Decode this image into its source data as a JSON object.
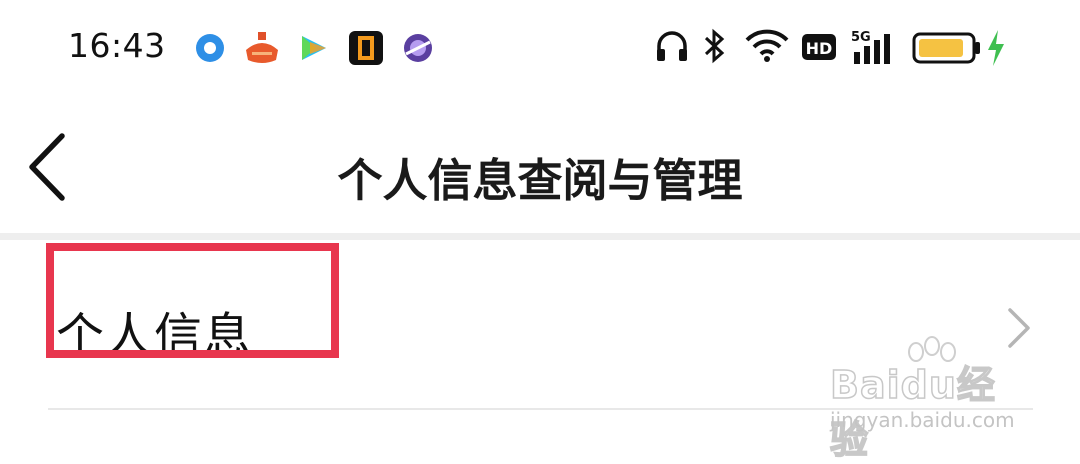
{
  "status_bar": {
    "time": "16:43",
    "app_icons": [
      "blue-circle-app-icon",
      "orange-pot-app-icon",
      "video-play-app-icon",
      "black-square-app-icon",
      "purple-planet-app-icon"
    ],
    "network": "5G",
    "hd_label": "HD",
    "battery_color": "#f5c242",
    "charging_color": "#3fbf50"
  },
  "header": {
    "title": "个人信息查阅与管理"
  },
  "list": {
    "items": [
      {
        "label": "个人信息"
      }
    ]
  },
  "annotation": {
    "highlight_color": "#e8364e"
  },
  "watermark": {
    "brand": "Baidu经验",
    "url": "jingyan.baidu.com"
  }
}
